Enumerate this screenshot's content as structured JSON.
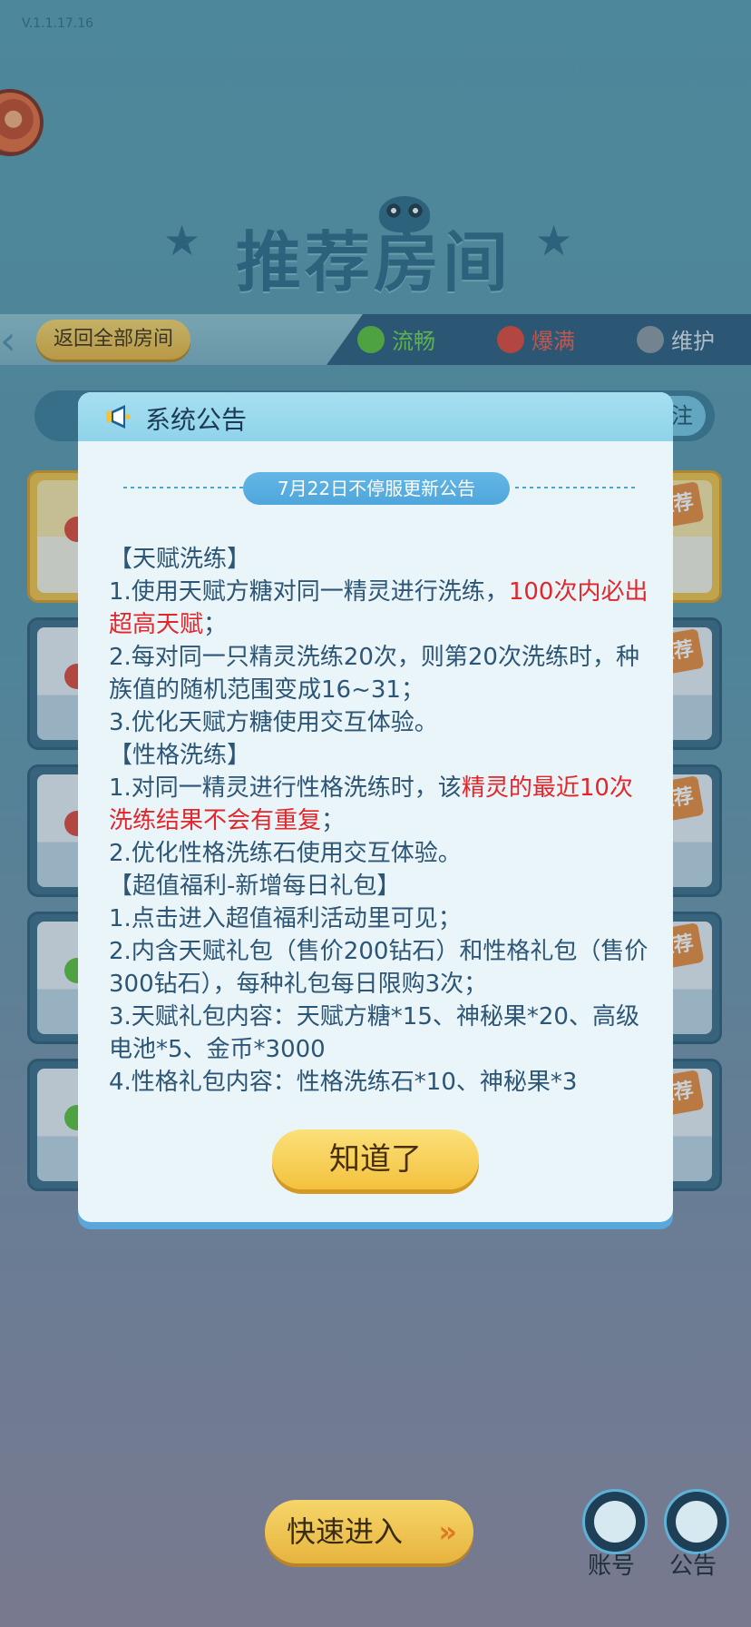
{
  "app": {
    "version": "V.1.1.17.16",
    "page_title": "推荐房间"
  },
  "filter_bar": {
    "back_all_rooms": "返回全部房间",
    "statuses": [
      {
        "label": "流畅",
        "color": "#5cc039"
      },
      {
        "label": "爆满",
        "color": "#e1473a"
      },
      {
        "label": "维护",
        "color": "#8c97a0"
      }
    ]
  },
  "search": {
    "right_label": "注"
  },
  "room_cards": [
    {
      "tag": "推荐",
      "style": "gold"
    },
    {
      "tag": "推荐",
      "style": "blue"
    },
    {
      "tag": "推荐",
      "style": "blue"
    },
    {
      "tag": "推荐",
      "style": "blue"
    },
    {
      "tag": "推荐",
      "style": "blue"
    }
  ],
  "dialog": {
    "title": "系统公告",
    "notice_title": "7月22日不停服更新公告",
    "confirm_button": "知道了",
    "lines": [
      {
        "text": "【天赋洗练】"
      },
      {
        "text": "1.使用天赋方糖对同一精灵进行洗练，",
        "red": "100次内必出超高天赋",
        "after": "；"
      },
      {
        "text": "2.每对同一只精灵洗练20次，则第20次洗练时，种族值的随机范围变成16~31；"
      },
      {
        "text": "3.优化天赋方糖使用交互体验。"
      },
      {
        "text": "【性格洗练】"
      },
      {
        "text": "1.对同一精灵进行性格洗练时，该",
        "red": "精灵的最近10次洗练结果不会有重复",
        "after": "；"
      },
      {
        "text": "2.优化性格洗练石使用交互体验。"
      },
      {
        "text": "【超值福利-新增每日礼包】"
      },
      {
        "text": "1.点击进入超值福利活动里可见；"
      },
      {
        "text": "2.内含天赋礼包（售价200钻石）和性格礼包（售价300钻石），每种礼包每日限购3次；"
      },
      {
        "text": "3.天赋礼包内容：天赋方糖*15、神秘果*20、高级电池*5、金币*3000"
      },
      {
        "text": "4.性格礼包内容：性格洗练石*10、神秘果*3"
      }
    ]
  },
  "bottom": {
    "quick_enter": "快速进入",
    "account_label": "账号",
    "notice_label": "公告"
  },
  "colors": {
    "highlight_red": "#e3262b",
    "body_text": "#2d5575",
    "button_gold": "#f3c23d"
  }
}
